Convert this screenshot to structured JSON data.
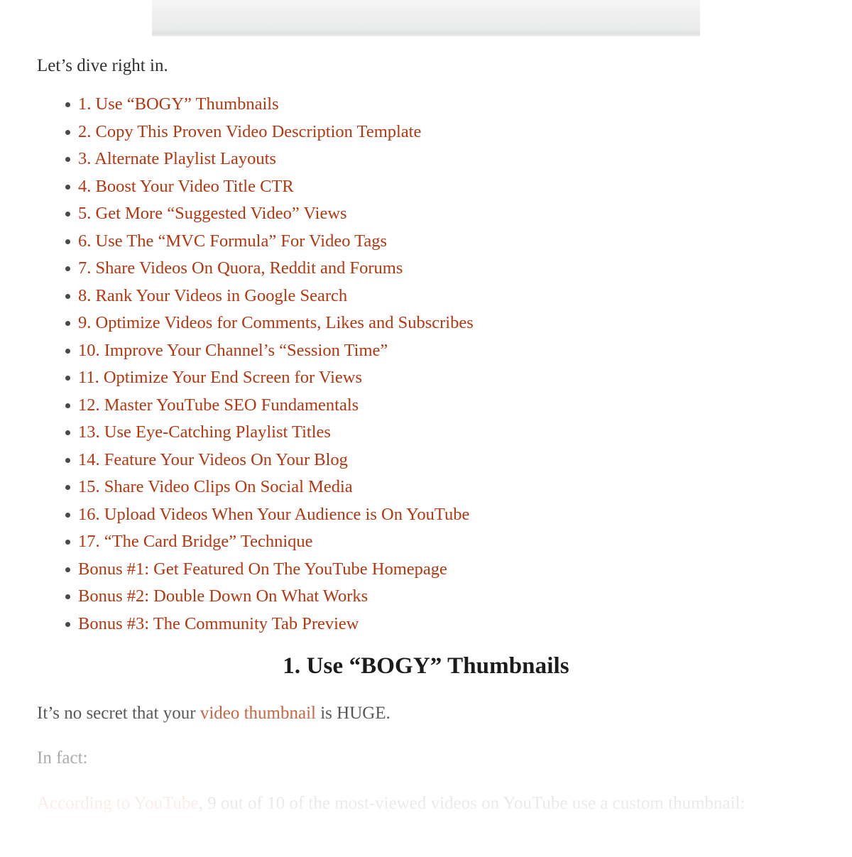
{
  "media_strip": {
    "name": "cut-off-image-top"
  },
  "article": {
    "intro_paragraph": "Let’s dive right in.",
    "toc_items": [
      {
        "label": "1. Use “BOGY” Thumbnails"
      },
      {
        "label": "2. Copy This Proven Video Description Template"
      },
      {
        "label": "3. Alternate Playlist Layouts"
      },
      {
        "label": "4. Boost Your Video Title CTR"
      },
      {
        "label": "5. Get More “Suggested Video” Views"
      },
      {
        "label": "6. Use The “MVC Formula” For Video Tags"
      },
      {
        "label": "7. Share Videos On Quora, Reddit and Forums"
      },
      {
        "label": "8. Rank Your Videos in Google Search"
      },
      {
        "label": "9. Optimize Videos for Comments, Likes and Subscribes"
      },
      {
        "label": "10. Improve Your Channel’s “Session Time”"
      },
      {
        "label": "11. Optimize Your End Screen for Views"
      },
      {
        "label": "12. Master YouTube SEO Fundamentals"
      },
      {
        "label": "13. Use Eye-Catching Playlist Titles"
      },
      {
        "label": "14. Feature Your Videos On Your Blog"
      },
      {
        "label": "15. Share Video Clips On Social Media"
      },
      {
        "label": "16. Upload Videos When Your Audience is On YouTube"
      },
      {
        "label": "17. “The Card Bridge” Technique"
      },
      {
        "label": "Bonus #1: Get Featured On The YouTube Homepage"
      },
      {
        "label": "Bonus #2: Double Down On What Works"
      },
      {
        "label": "Bonus #3: The Community Tab Preview"
      }
    ],
    "section_heading": "1. Use “BOGY” Thumbnails",
    "huge_paragraph": {
      "before_link": "It’s no secret that your ",
      "link": "video thumbnail",
      "after_link": " is HUGE."
    },
    "infact_paragraph": "In fact:",
    "stat_paragraph": {
      "link": "According to YouTube",
      "rest": ", 9 out of 10 of the most-viewed videos on YouTube use a custom thumbnail:"
    }
  },
  "colors": {
    "link": "#b6360f",
    "inline_link": "#bb4016",
    "faded_link": "#e8a085",
    "body_text": "#2f3030",
    "heading": "#1c1c1c",
    "faded_text": "#8f9193",
    "bullet": "#4a4a4a",
    "media_strip": "#efefef",
    "page_background": "#ffffff"
  }
}
